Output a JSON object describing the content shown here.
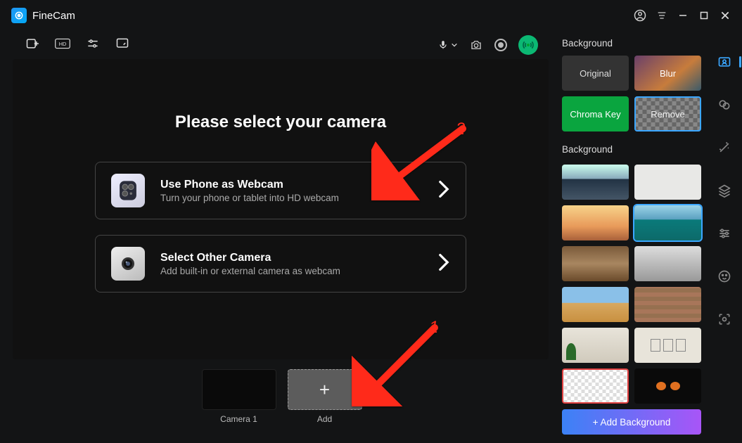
{
  "app": {
    "title": "FineCam"
  },
  "preview": {
    "title": "Please select your camera",
    "options": [
      {
        "title": "Use Phone as Webcam",
        "sub": "Turn your phone or tablet into HD webcam"
      },
      {
        "title": "Select Other Camera",
        "sub": "Add built-in or external camera as webcam"
      }
    ]
  },
  "scenes": {
    "camera1": "Camera 1",
    "add": "Add"
  },
  "panel": {
    "bgModesTitle": "Background",
    "modes": {
      "original": "Original",
      "blur": "Blur",
      "chroma": "Chroma Key",
      "remove": "Remove"
    },
    "bgThumbsTitle": "Background",
    "addBg": "+ Add Background"
  },
  "annotations": {
    "arrow1": "1",
    "arrow2": "2"
  },
  "colors": {
    "accent": "#3ba7ff",
    "live": "#0bb873",
    "arrow": "#ff2a1a"
  }
}
